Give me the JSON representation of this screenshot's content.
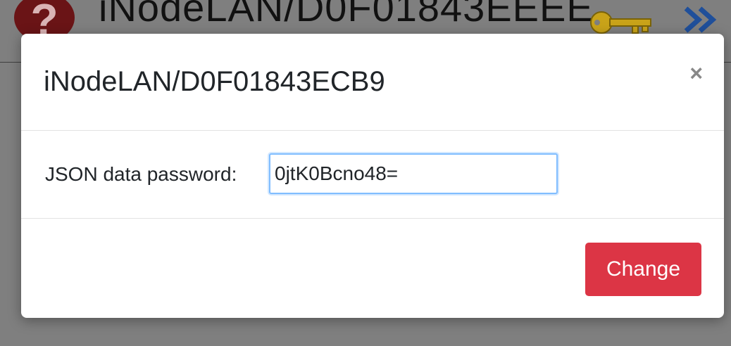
{
  "background": {
    "title": "iNodeLAN/D0F01843EEEE",
    "help_icon_glyph": "?",
    "icons": [
      "help-icon",
      "key-icon",
      "forward-icon"
    ]
  },
  "modal": {
    "title": "iNodeLAN/D0F01843ECB9",
    "close_glyph": "×",
    "password_label": "JSON data password:",
    "password_value": "0jtK0Bcno48=",
    "change_label": "Change"
  },
  "colors": {
    "backdrop": "#7f7f7f",
    "danger": "#dc3545",
    "input_focus_border": "#80bdff"
  }
}
